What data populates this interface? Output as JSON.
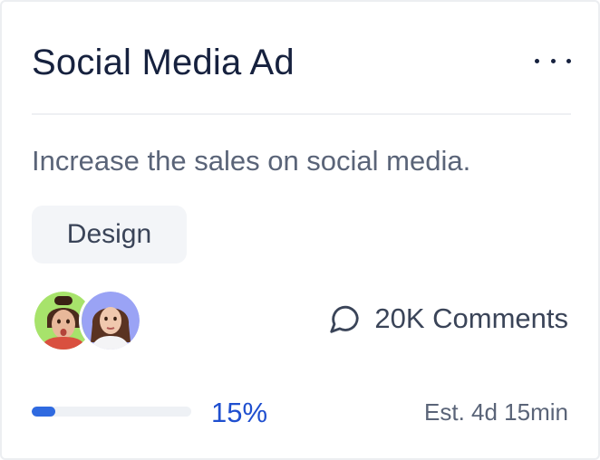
{
  "card": {
    "title": "Social Media Ad",
    "more_icon": "more-horizontal-icon",
    "description": "Increase the sales on social media.",
    "tag": "Design",
    "avatars": [
      {
        "name": "avatar-1",
        "bg_color": "#a7e36b"
      },
      {
        "name": "avatar-2",
        "bg_color": "#9aa3f5"
      }
    ],
    "comments": {
      "icon": "comment-bubble-icon",
      "label": "20K Comments"
    },
    "progress": {
      "value": 0.15,
      "label": "15%",
      "fill_color": "#2f6ae0"
    },
    "estimate": "Est. 4d 15min"
  }
}
